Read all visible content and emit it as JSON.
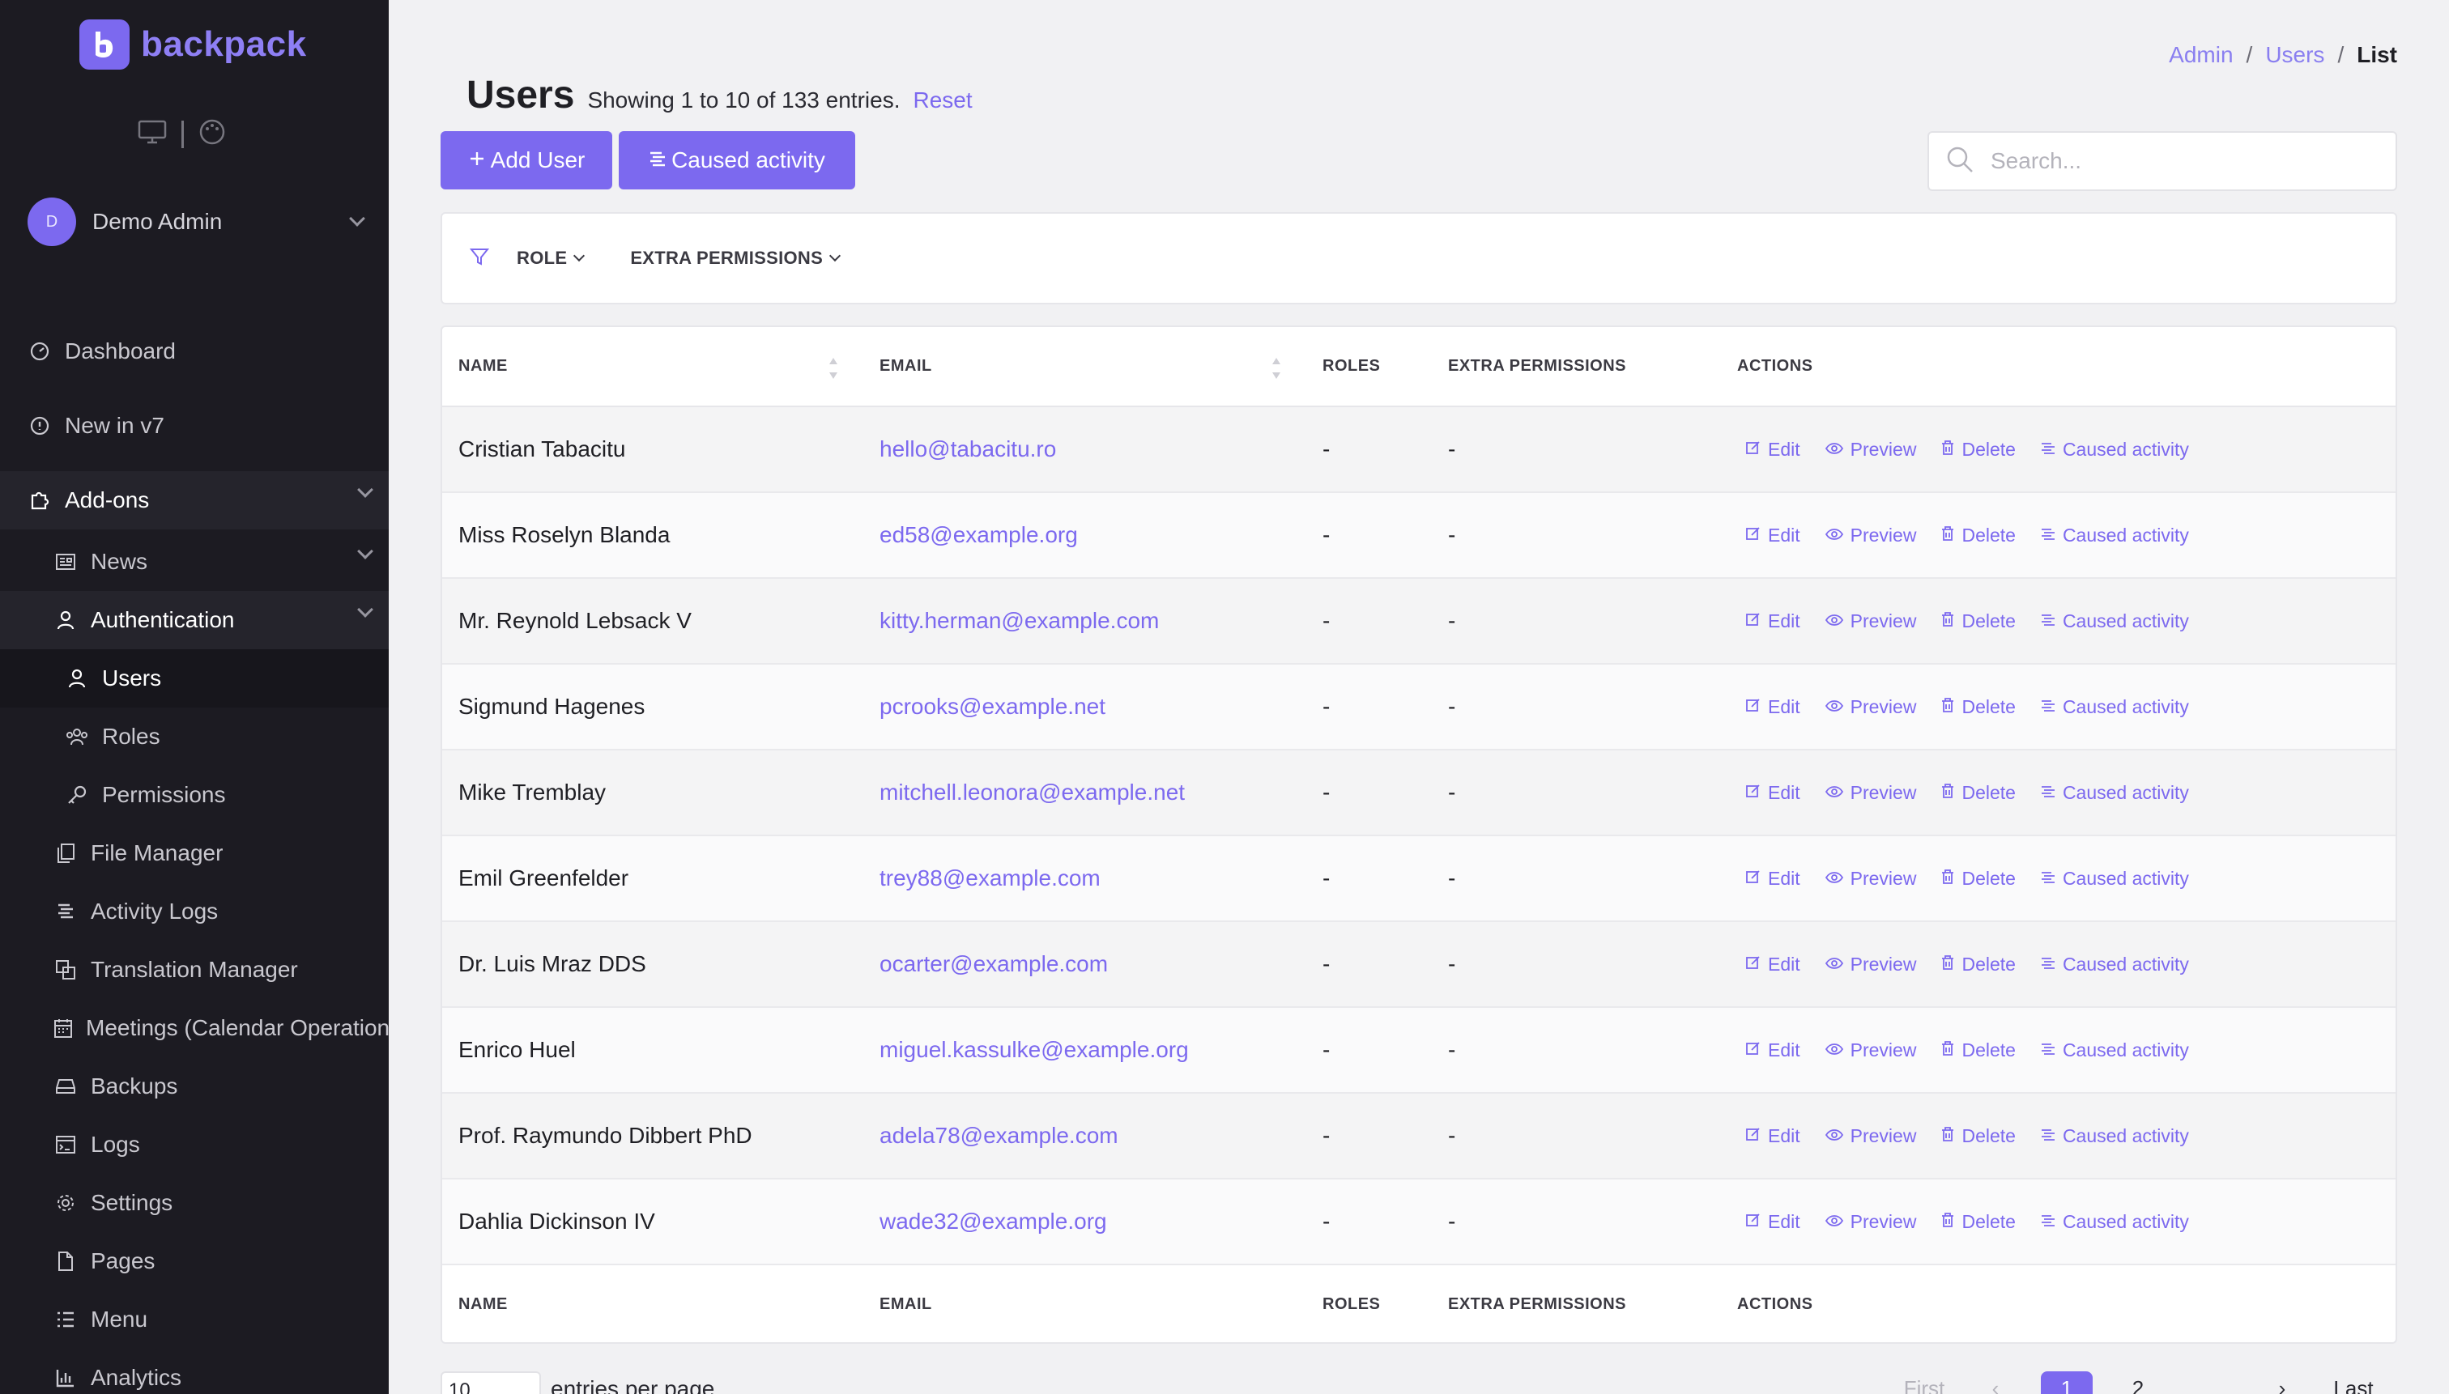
{
  "brand": {
    "name": "backpack"
  },
  "user": {
    "initial": "D",
    "name": "Demo Admin"
  },
  "nav": {
    "dashboard": "Dashboard",
    "new_in_v7": "New in v7",
    "addons": "Add-ons",
    "news": "News",
    "authentication": "Authentication",
    "users": "Users",
    "roles": "Roles",
    "permissions": "Permissions",
    "file_manager": "File Manager",
    "activity_logs": "Activity Logs",
    "translation_manager": "Translation Manager",
    "meetings": "Meetings (Calendar Operation)",
    "backups": "Backups",
    "logs": "Logs",
    "settings": "Settings",
    "pages": "Pages",
    "menu": "Menu",
    "analytics": "Analytics"
  },
  "breadcrumb": {
    "admin": "Admin",
    "users": "Users",
    "list": "List",
    "sep": "/"
  },
  "header": {
    "title": "Users",
    "subtitle": "Showing 1 to 10 of 133 entries.",
    "reset": "Reset",
    "add_button": "Add User",
    "activity_button": "Caused activity",
    "search_placeholder": "Search..."
  },
  "filters": {
    "role": "ROLE",
    "extra_permissions": "EXTRA PERMISSIONS"
  },
  "table": {
    "columns": {
      "name": "NAME",
      "email": "EMAIL",
      "roles": "ROLES",
      "extra": "EXTRA PERMISSIONS",
      "actions": "ACTIONS"
    },
    "action_labels": {
      "edit": "Edit",
      "preview": "Preview",
      "delete": "Delete",
      "activity": "Caused activity"
    },
    "rows": [
      {
        "name": "Cristian Tabacitu",
        "email": "hello@tabacitu.ro",
        "roles": "-",
        "extra": "-"
      },
      {
        "name": "Miss Roselyn Blanda",
        "email": "ed58@example.org",
        "roles": "-",
        "extra": "-"
      },
      {
        "name": "Mr. Reynold Lebsack V",
        "email": "kitty.herman@example.com",
        "roles": "-",
        "extra": "-"
      },
      {
        "name": "Sigmund Hagenes",
        "email": "pcrooks@example.net",
        "roles": "-",
        "extra": "-"
      },
      {
        "name": "Mike Tremblay",
        "email": "mitchell.leonora@example.net",
        "roles": "-",
        "extra": "-"
      },
      {
        "name": "Emil Greenfelder",
        "email": "trey88@example.com",
        "roles": "-",
        "extra": "-"
      },
      {
        "name": "Dr. Luis Mraz DDS",
        "email": "ocarter@example.com",
        "roles": "-",
        "extra": "-"
      },
      {
        "name": "Enrico Huel",
        "email": "miguel.kassulke@example.org",
        "roles": "-",
        "extra": "-"
      },
      {
        "name": "Prof. Raymundo Dibbert PhD",
        "email": "adela78@example.com",
        "roles": "-",
        "extra": "-"
      },
      {
        "name": "Dahlia Dickinson IV",
        "email": "wade32@example.org",
        "roles": "-",
        "extra": "-"
      }
    ]
  },
  "footer": {
    "per_page_value": "10",
    "per_page_label": "entries per page",
    "first": "First",
    "prev": "‹",
    "page1": "1",
    "page2": "2",
    "next": "›",
    "last": "Last"
  },
  "colors": {
    "accent": "#7c69ef",
    "sidebar": "#1c1b22"
  }
}
